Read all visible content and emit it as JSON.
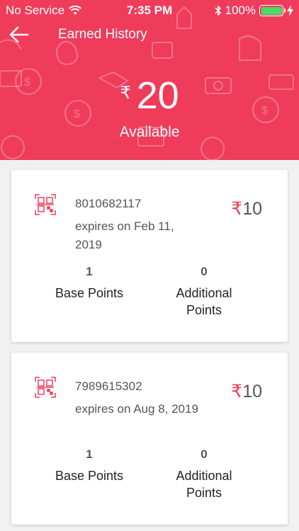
{
  "status_bar": {
    "carrier": "No Service",
    "time": "7:35 PM",
    "battery": "100%"
  },
  "header": {
    "title": "Earned History",
    "currency_symbol": "₹",
    "balance": "20",
    "balance_label": "Available"
  },
  "colors": {
    "brand": "#ef3c5b",
    "battery": "#4cd964"
  },
  "history": [
    {
      "code": "8010682117",
      "expires": "expires on Feb 11, 2019",
      "price_symbol": "₹",
      "price": "10",
      "base_points": "1",
      "base_points_label": "Base Points",
      "additional_points": "0",
      "additional_points_label": "Additional Points"
    },
    {
      "code": "7989615302",
      "expires": "expires on Aug 8, 2019",
      "price_symbol": "₹",
      "price": "10",
      "base_points": "1",
      "base_points_label": "Base Points",
      "additional_points": "0",
      "additional_points_label": "Additional Points"
    }
  ]
}
